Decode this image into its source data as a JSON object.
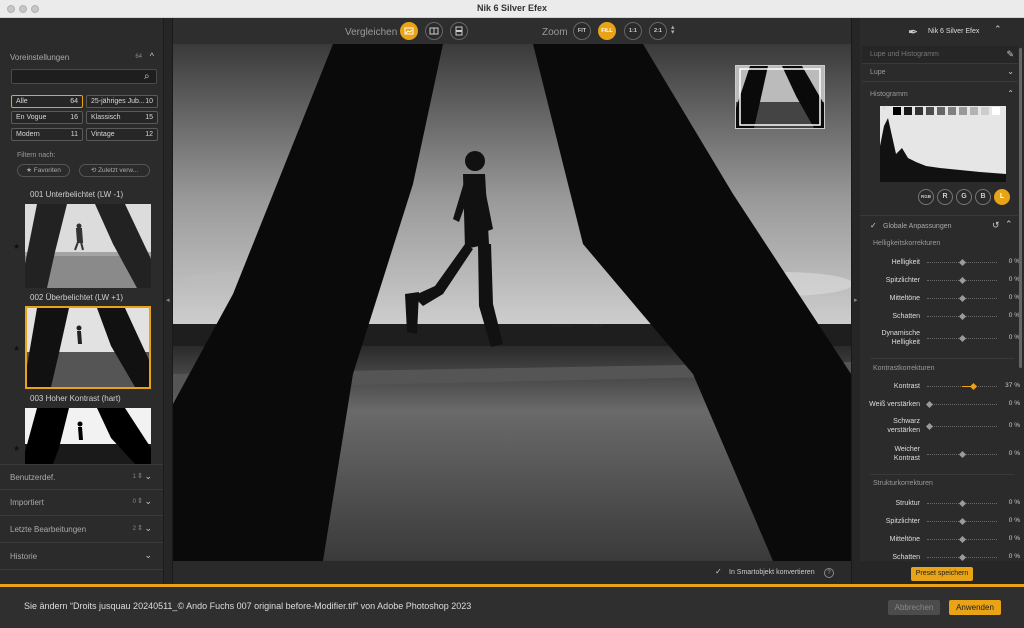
{
  "window": {
    "title": "Nik 6 Silver Efex"
  },
  "left": {
    "presets": {
      "title": "Voreinstellungen",
      "count": "64"
    },
    "search": {
      "value": "",
      "placeholder": ""
    },
    "categories": [
      {
        "label": "Alle",
        "count": "64"
      },
      {
        "label": "25-jähriges Jub...",
        "count": "10"
      },
      {
        "label": "En Vogue",
        "count": "16"
      },
      {
        "label": "Klassisch",
        "count": "15"
      },
      {
        "label": "Modern",
        "count": "11"
      },
      {
        "label": "Vintage",
        "count": "12"
      }
    ],
    "filter_label": "Filtern nach:",
    "filters": [
      "★ Favoriten",
      "⟲ Zuletzt verw..."
    ],
    "preset_list": [
      "001 Unterbelichtet (LW -1)",
      "002 Überbelichtet (LW +1)",
      "003 Hoher Kontrast (hart)"
    ],
    "sections": [
      {
        "title": "Benutzerdef.",
        "count": "1"
      },
      {
        "title": "Importiert",
        "count": "0"
      },
      {
        "title": "Letzte Bearbeitungen",
        "count": "2"
      },
      {
        "title": "Historie",
        "count": ""
      }
    ]
  },
  "toolbar": {
    "compare_label": "Vergleichen",
    "zoom_label": "Zoom",
    "zoom_options": [
      "FIT",
      "FILL",
      "1:1",
      "2:1"
    ],
    "zoom_selected": "FILL",
    "icons": [
      "compare-single-icon",
      "compare-split-icon",
      "compare-side-icon"
    ]
  },
  "bottom": {
    "smart_object_label": "In Smartobjekt konvertieren",
    "smart_object_checked": true,
    "help": "?"
  },
  "right": {
    "app_name": "Nik 6 Silver Efex",
    "loupe_header": "Lupe und Histogramm",
    "loupe": "Lupe",
    "histogram": "Histogramm",
    "channels": [
      "RGB",
      "R",
      "G",
      "B",
      "L"
    ],
    "channel_selected": "L",
    "global_adjustments": "Globale Anpassungen",
    "groups": [
      {
        "title": "Helligkeitskorrekturen",
        "sliders": [
          {
            "label": "Helligkeit",
            "value": "0 %",
            "position": 0.5
          },
          {
            "label": "Spitzlichter",
            "value": "0 %",
            "position": 0.5
          },
          {
            "label": "Mitteltöne",
            "value": "0 %",
            "position": 0.5
          },
          {
            "label": "Schatten",
            "value": "0 %",
            "position": 0.5
          },
          {
            "label": "Dynamische Helligkeit",
            "value": "0 %",
            "position": 0.5
          }
        ]
      },
      {
        "title": "Kontrastkorrekturen",
        "sliders": [
          {
            "label": "Kontrast",
            "value": "37 %",
            "position": 0.68
          },
          {
            "label": "Weiß verstärken",
            "value": "0 %",
            "position": 0.0
          },
          {
            "label": "Schwarz verstärken",
            "value": "0 %",
            "position": 0.0
          },
          {
            "label": "Weicher Kontrast",
            "value": "0 %",
            "position": 0.5
          }
        ]
      },
      {
        "title": "Strukturkorrekturen",
        "sliders": [
          {
            "label": "Struktur",
            "value": "0 %",
            "position": 0.5
          },
          {
            "label": "Spitzlichter",
            "value": "0 %",
            "position": 0.5
          },
          {
            "label": "Mitteltöne",
            "value": "0 %",
            "position": 0.5
          },
          {
            "label": "Schatten",
            "value": "0 %",
            "position": 0.5
          }
        ]
      }
    ],
    "save_preset": "Preset speichern"
  },
  "footer": {
    "message": "Sie ändern “Droits jusquau 20240511_© Ando Fuchs 007 original before-Modifier.tif” von Adobe Photoshop 2023",
    "cancel": "Abbrechen",
    "apply": "Anwenden"
  },
  "colors": {
    "accent": "#e8a317",
    "panel": "#2b2b2b",
    "footer": "#2f2f2f"
  }
}
